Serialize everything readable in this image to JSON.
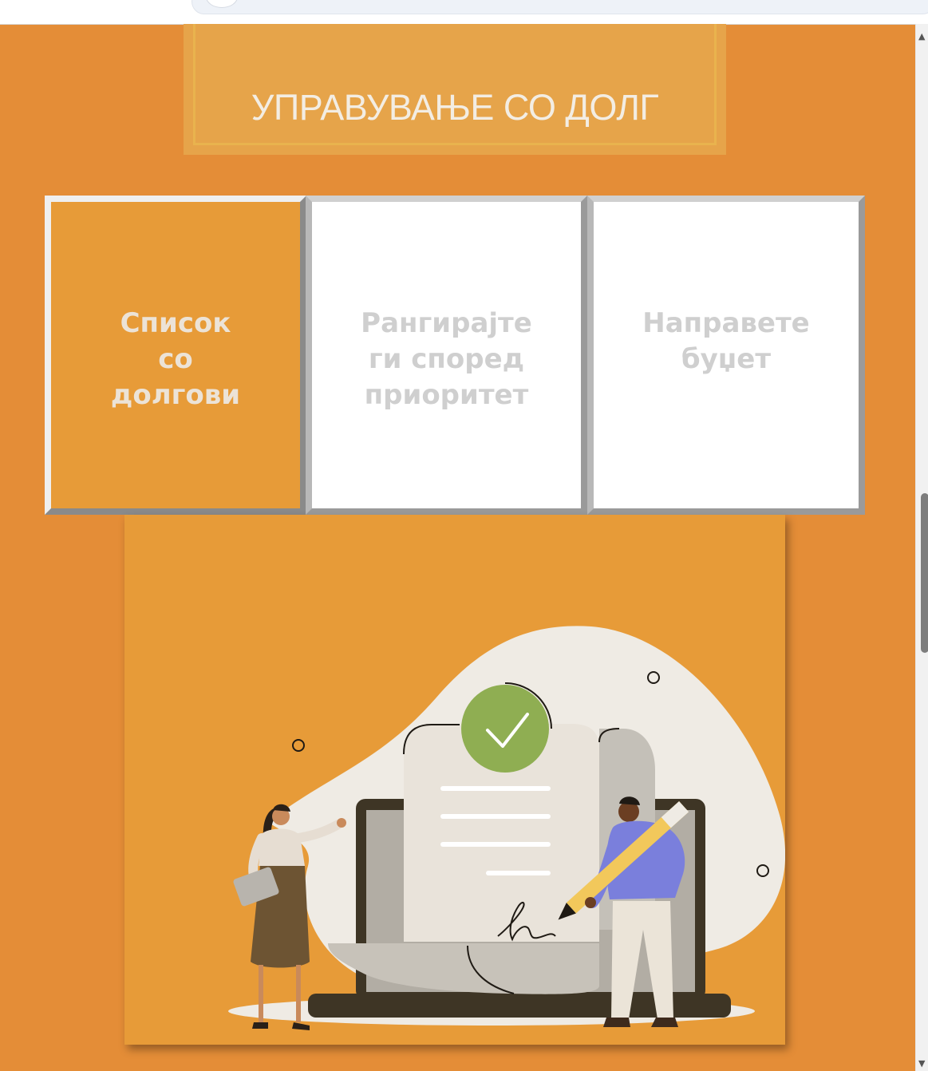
{
  "title": "УПРАВУВАЊЕ СО ДОЛГ",
  "tabs": [
    {
      "label": "Список со долгови",
      "selected": true
    },
    {
      "label": "Рангирајте ги според приоритет",
      "selected": false
    },
    {
      "label": "Направете буџет",
      "selected": false
    }
  ],
  "illustration": {
    "icon": "signed-document-approval-illustration"
  },
  "colors": {
    "page_background": "#e48d37",
    "title_box": "#e6a44a",
    "selected_tab": "#e79b38",
    "unselected_tab": "#ffffff",
    "tab_text_unselected": "#cfcfcf",
    "checkmark_green": "#8fae52",
    "person_shirt_blue": "#7a7fdc"
  }
}
